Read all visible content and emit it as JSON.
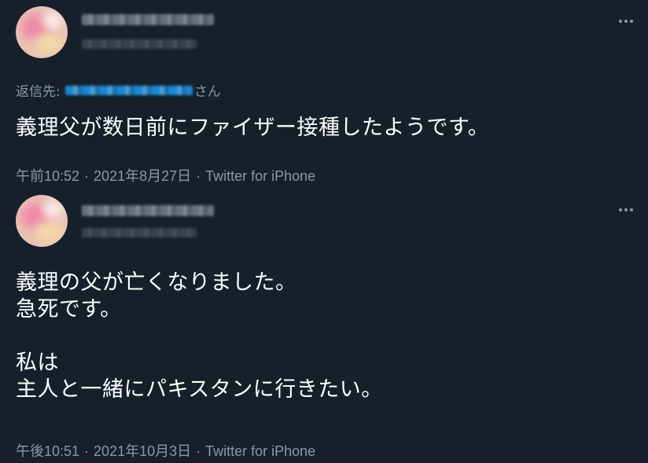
{
  "tweets": [
    {
      "reply": {
        "label": "返信先:",
        "suffix": "さん"
      },
      "text": "義理父が数日前にファイザー接種したようです。",
      "time": "午前10:52",
      "date": "2021年8月27日",
      "separator": "·",
      "source": "Twitter for iPhone",
      "more_icon": "more-horizontal-icon"
    },
    {
      "text": "義理の父が亡くなりました。\n急死です。\n\n私は\n主人と一緒にパキスタンに行きたい。",
      "time": "午後10:51",
      "date": "2021年10月3日",
      "separator": "·",
      "source": "Twitter for iPhone",
      "more_icon": "more-horizontal-icon"
    }
  ],
  "colors": {
    "background": "#15202b",
    "primary_text": "#ffffff",
    "secondary_text": "#8b98a5",
    "link_blue": "#1d9bf0"
  }
}
